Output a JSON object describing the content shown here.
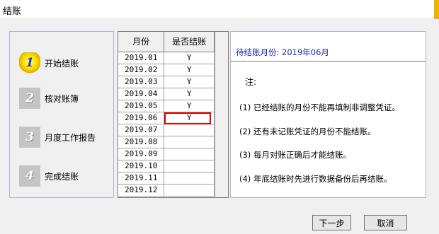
{
  "window": {
    "title": "结账"
  },
  "steps": [
    {
      "number": "1",
      "label": "开始结账",
      "active": true
    },
    {
      "number": "2",
      "label": "核对账簿",
      "active": false
    },
    {
      "number": "3",
      "label": "月度工作报告",
      "active": false
    },
    {
      "number": "4",
      "label": "完成结账",
      "active": false
    }
  ],
  "table": {
    "headers": [
      "月份",
      "是否结账"
    ],
    "rows": [
      {
        "month": "2019.01",
        "status": "Y"
      },
      {
        "month": "2019.02",
        "status": "Y"
      },
      {
        "month": "2019.03",
        "status": "Y"
      },
      {
        "month": "2019.04",
        "status": "Y"
      },
      {
        "month": "2019.05",
        "status": "Y"
      },
      {
        "month": "2019.06",
        "status": "Y"
      },
      {
        "month": "2019.07",
        "status": ""
      },
      {
        "month": "2019.08",
        "status": ""
      },
      {
        "month": "2019.09",
        "status": ""
      },
      {
        "month": "2019.10",
        "status": ""
      },
      {
        "month": "2019.11",
        "status": ""
      },
      {
        "month": "2019.12",
        "status": ""
      }
    ],
    "selected_index": 5
  },
  "info": {
    "pending": "待结账月份: 2019年06月",
    "note_title": "注:",
    "notes": [
      "(1) 已经结账的月份不能再填制非调整凭证。",
      "(2) 还有未记账凭证的月份不能结账。",
      "(3) 每月对账正确后才能结账。",
      "(4) 年底结账时先进行数据备份后再结账。"
    ]
  },
  "buttons": {
    "next": "下一步",
    "cancel": "取消"
  }
}
